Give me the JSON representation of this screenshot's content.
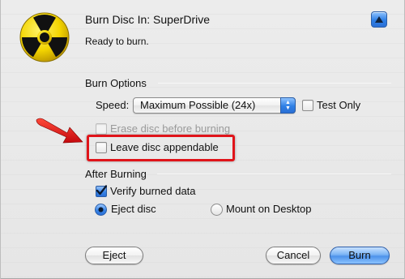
{
  "header": {
    "title": "Burn Disc In:  SuperDrive",
    "status": "Ready to burn.",
    "collapse_icon": "triangle-up-icon"
  },
  "burn_options": {
    "section_label": "Burn Options",
    "speed_label": "Speed:",
    "speed_value": "Maximum Possible (24x)",
    "test_only_label": "Test Only",
    "test_only_checked": false,
    "erase_label": "Erase disc before burning",
    "erase_disabled": true,
    "leave_appendable_label": "Leave disc appendable",
    "leave_appendable_checked": false
  },
  "after_burning": {
    "section_label": "After Burning",
    "verify_label": "Verify burned data",
    "verify_checked": true,
    "eject_label": "Eject disc",
    "mount_label": "Mount on Desktop",
    "selected_option": "Eject disc"
  },
  "buttons": {
    "eject": "Eject",
    "cancel": "Cancel",
    "burn": "Burn"
  },
  "colors": {
    "accent": "#2f7fe5",
    "highlight": "#e0141a"
  }
}
